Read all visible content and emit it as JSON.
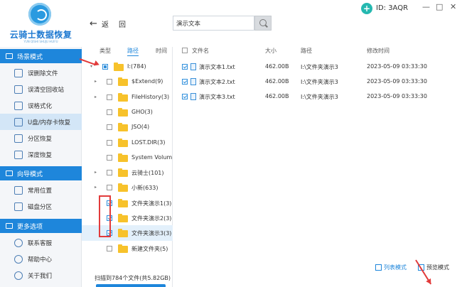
{
  "app": {
    "name": "云骑士数据恢复",
    "subtitle": "YUN QISHI SHUJU HUIFU",
    "id_label": "ID: 3AQR"
  },
  "sidebar": {
    "sections": [
      {
        "title": "场景模式",
        "items": [
          {
            "label": "误删除文件",
            "icon": "delete-file-icon"
          },
          {
            "label": "误清空回收站",
            "icon": "recycle-bin-icon"
          },
          {
            "label": "误格式化",
            "icon": "format-icon"
          },
          {
            "label": "U盘/内存卡恢复",
            "icon": "usb-icon",
            "active": true
          },
          {
            "label": "分区恢复",
            "icon": "partition-icon"
          },
          {
            "label": "深度恢复",
            "icon": "deep-scan-icon"
          }
        ]
      },
      {
        "title": "向导模式",
        "items": [
          {
            "label": "常用位置",
            "icon": "location-icon"
          },
          {
            "label": "磁盘分区",
            "icon": "disk-icon"
          }
        ]
      },
      {
        "title": "更多选项",
        "items": [
          {
            "label": "联系客服",
            "icon": "support-icon"
          },
          {
            "label": "帮助中心",
            "icon": "help-icon"
          },
          {
            "label": "关于我们",
            "icon": "about-icon"
          }
        ]
      }
    ]
  },
  "toolbar": {
    "back_label": "返",
    "home_label": "回",
    "search_value": "演示文本"
  },
  "tree": {
    "tabs": [
      "类型",
      "路径",
      "时间"
    ],
    "active_tab": "路径",
    "rows": [
      {
        "label": "I:(784)",
        "level": 0,
        "state": "partial",
        "expander": "open"
      },
      {
        "label": "$Extend(9)",
        "level": 1,
        "state": "none",
        "expander": "closed"
      },
      {
        "label": "FileHistory(3)",
        "level": 1,
        "state": "none",
        "expander": "closed"
      },
      {
        "label": "GHO(3)",
        "level": 1,
        "state": "none"
      },
      {
        "label": "JSO(4)",
        "level": 1,
        "state": "none"
      },
      {
        "label": "LOST.DIR(3)",
        "level": 1,
        "state": "none"
      },
      {
        "label": "System Volum...",
        "level": 1,
        "state": "none"
      },
      {
        "label": "云骑士(101)",
        "level": 1,
        "state": "none",
        "expander": "closed"
      },
      {
        "label": "小新(633)",
        "level": 1,
        "state": "none",
        "expander": "closed"
      },
      {
        "label": "文件夹演示1(3)",
        "level": 1,
        "state": "checked"
      },
      {
        "label": "文件夹演示2(3)",
        "level": 1,
        "state": "checked"
      },
      {
        "label": "文件夹演示3(3)",
        "level": 1,
        "state": "checked",
        "selected": true
      },
      {
        "label": "新建文件夹(5)",
        "level": 1,
        "state": "none"
      }
    ]
  },
  "file_list": {
    "headers": {
      "name": "文件名",
      "size": "大小",
      "path": "路径",
      "modified": "修改时间"
    },
    "rows": [
      {
        "name": "演示文本1.txt",
        "size": "462.00B",
        "path": "I:\\文件夹演示3",
        "modified": "2023-05-09 03:33:30"
      },
      {
        "name": "演示文本2.txt",
        "size": "462.00B",
        "path": "I:\\文件夹演示3",
        "modified": "2023-05-09 03:33:30"
      },
      {
        "name": "演示文本3.txt",
        "size": "462.00B",
        "path": "I:\\文件夹演示3",
        "modified": "2023-05-09 03:33:30"
      }
    ]
  },
  "status": {
    "scan_summary": "扫描到784个文件(共5.82GB)"
  },
  "view_modes": {
    "list_label": "列表模式",
    "preview_label": "预览模式"
  },
  "colors": {
    "accent": "#1e86db",
    "active_nav": "#d3e6f7",
    "folder": "#f7c22b",
    "annotation": "#e23b3b"
  }
}
